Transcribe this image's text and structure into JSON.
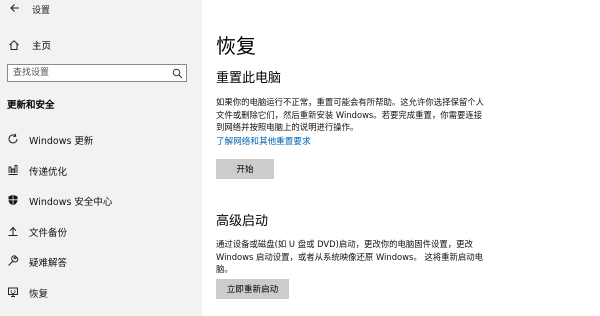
{
  "window": {
    "title": "设置"
  },
  "sidebar": {
    "home_label": "主页",
    "search_placeholder": "查找设置",
    "section_heading": "更新和安全",
    "items": [
      {
        "label": "Windows 更新",
        "icon": "refresh-icon"
      },
      {
        "label": "传递优化",
        "icon": "delivery-optimization-icon"
      },
      {
        "label": "Windows 安全中心",
        "icon": "shield-icon"
      },
      {
        "label": "文件备份",
        "icon": "backup-icon"
      },
      {
        "label": "疑难解答",
        "icon": "wrench-icon"
      },
      {
        "label": "恢复",
        "icon": "recovery-icon"
      }
    ]
  },
  "main": {
    "title": "恢复",
    "reset": {
      "title": "重置此电脑",
      "description_lines": [
        "如果你的电脑运行不正常，重置可能会有所帮助。这允许你选择保留个人",
        "文件或删除它们，然后重新安装 Windows。若要完成重置，你需要连接",
        "到网络并按照电脑上的说明进行操作。"
      ],
      "link": "了解网络和其他重置要求",
      "button": "开始"
    },
    "advanced": {
      "title": "高级启动",
      "description_lines": [
        "通过设备或磁盘(如 U 盘或 DVD)启动，更改你的电脑固件设置，更改",
        "Windows 启动设置，或者从系统映像还原 Windows。 这将重新启动电",
        "脑。"
      ],
      "button": "立即重新启动"
    }
  },
  "colors": {
    "sidebar_bg": "#f2f2f2",
    "link": "#0063b1",
    "button_bg": "#cccccc"
  }
}
